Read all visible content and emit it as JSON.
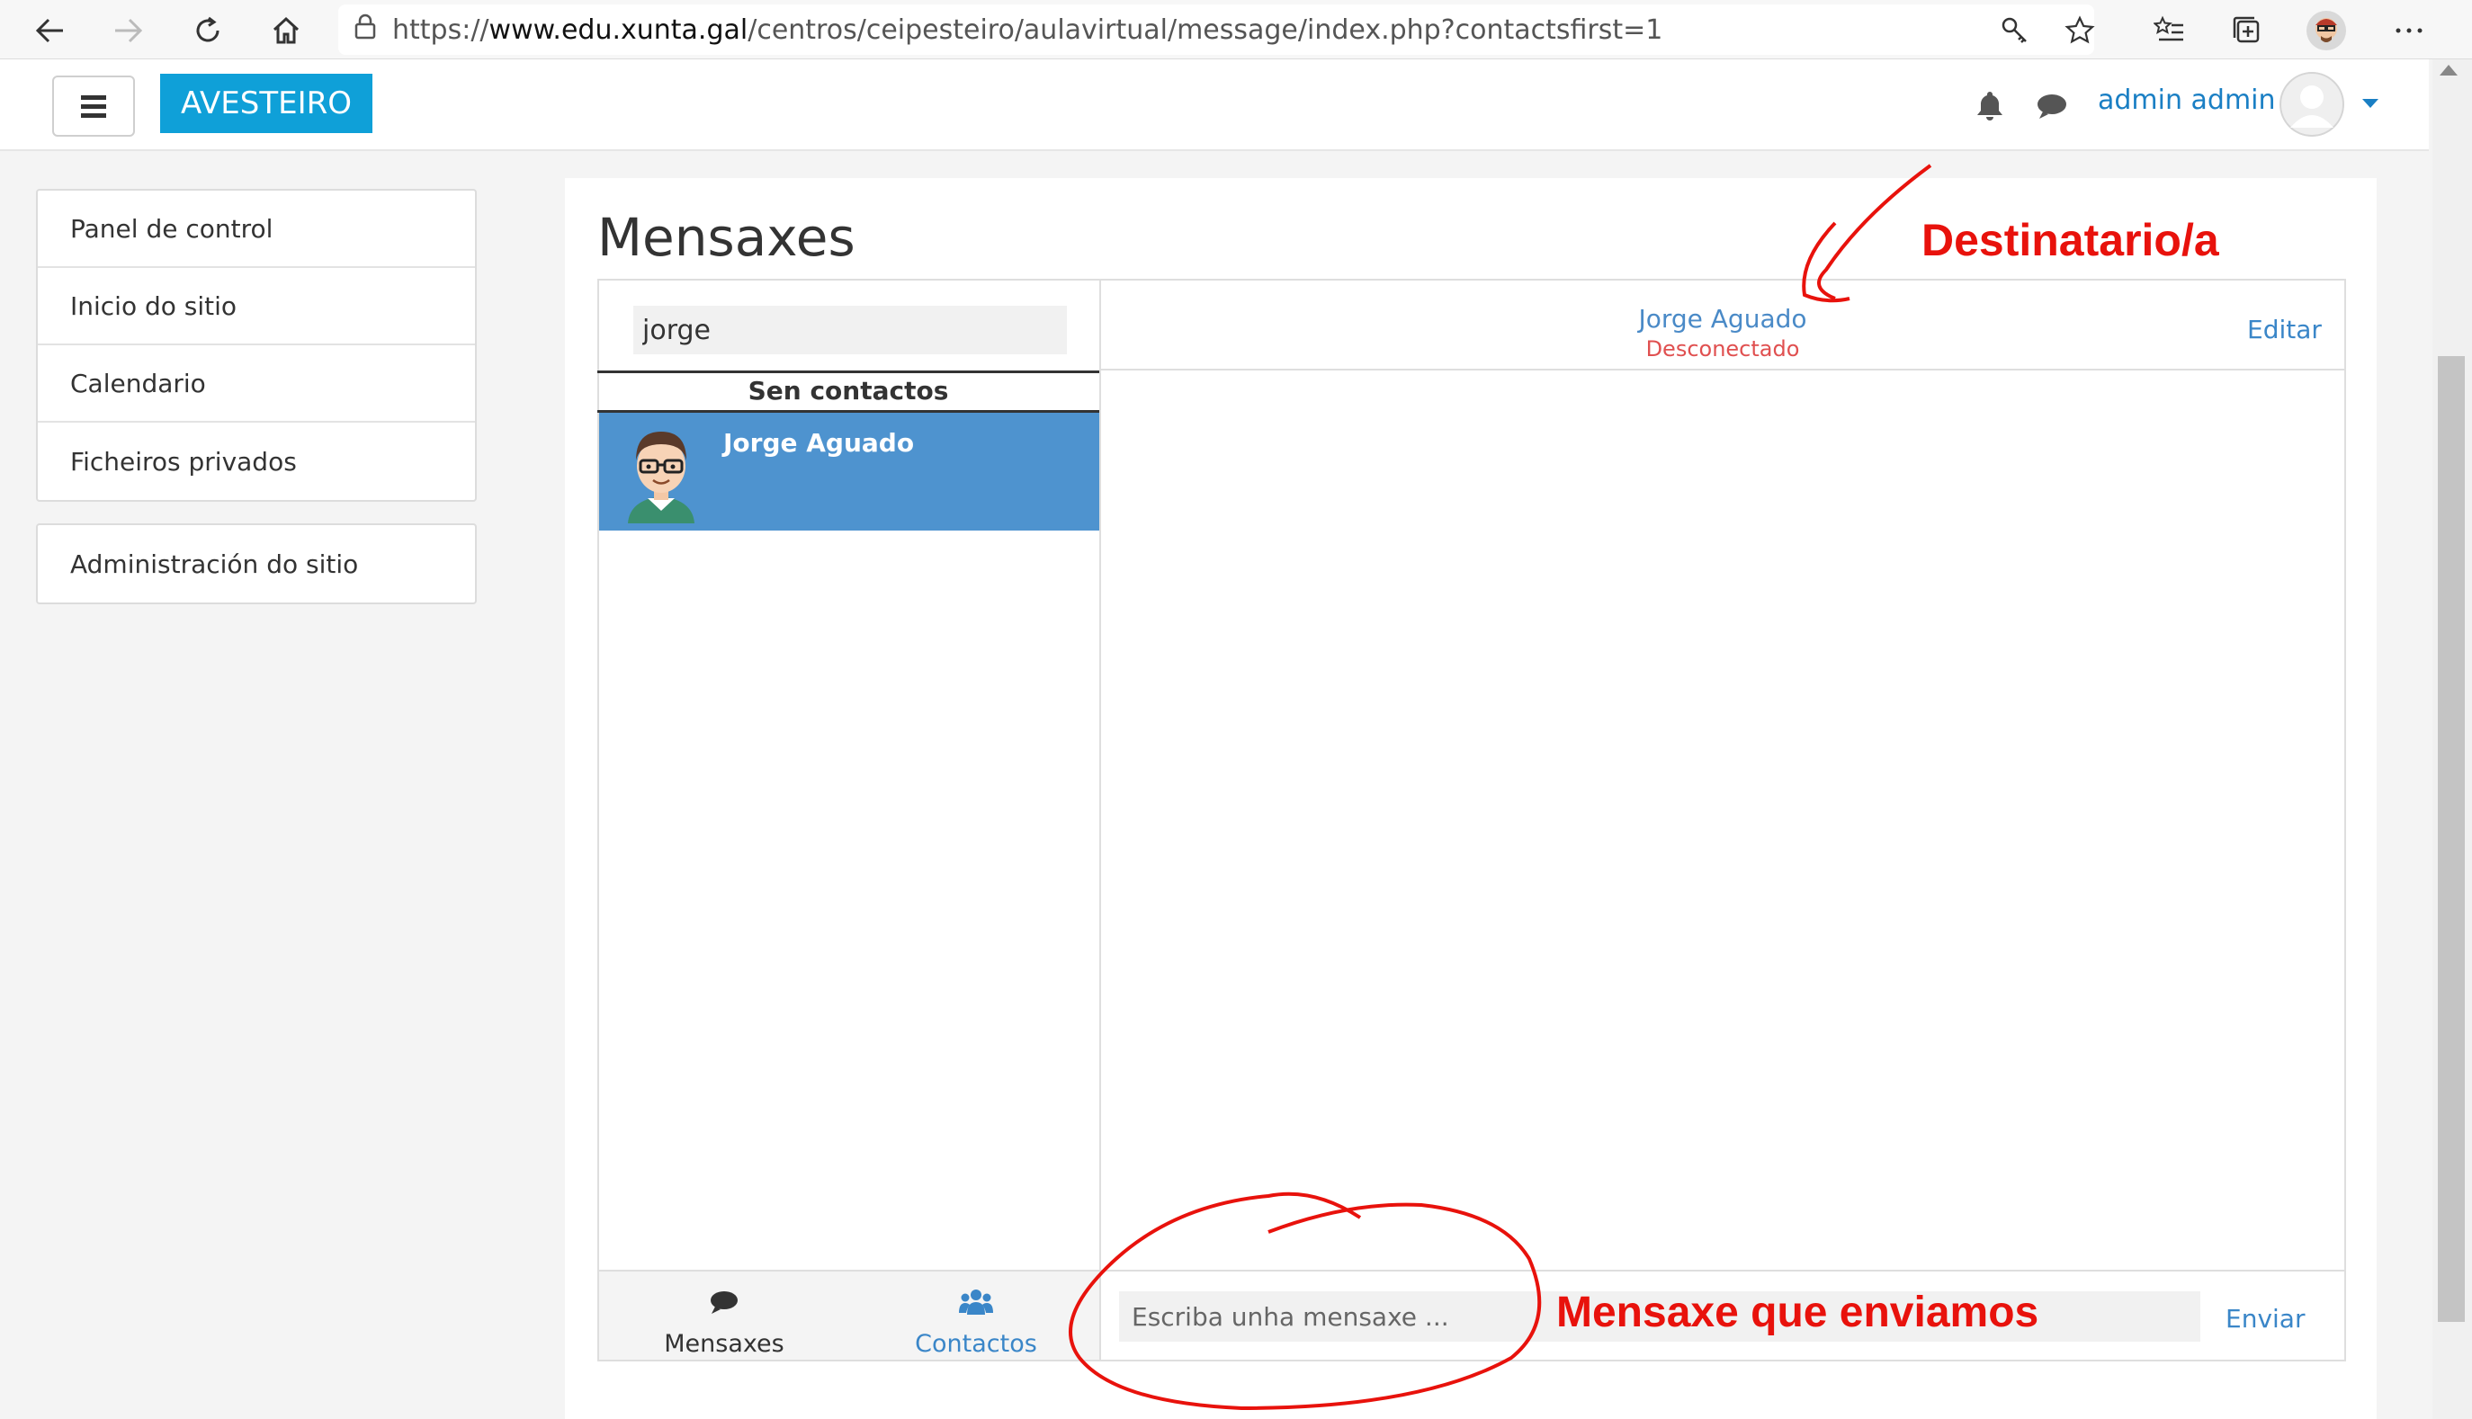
{
  "browser": {
    "url_prefix": "https://",
    "url_domain": "www.edu.xunta.gal",
    "url_path": "/centros/ceipesteiro/aulavirtual/message/index.php?contactsfirst=1"
  },
  "navbar": {
    "brand": "AVESTEIRO",
    "user_name": "admin admin"
  },
  "sidebar": {
    "items": [
      "Panel de control",
      "Inicio do sitio",
      "Calendario",
      "Ficheiros privados"
    ],
    "admin_item": "Administración do sitio"
  },
  "messages": {
    "page_title": "Mensaxes",
    "search_value": "jorge",
    "section_heading": "Sen contactos",
    "contact_name": "Jorge Aguado",
    "recipient_name": "Jorge Aguado",
    "recipient_status": "Desconectado",
    "edit_label": "Editar",
    "message_placeholder": "Escriba unha mensaxe ...",
    "send_label": "Enviar",
    "tabs": [
      "Mensaxes",
      "Contactos"
    ]
  },
  "annotations": {
    "recipient": "Destinatario/a",
    "message": "Mensaxe que enviamos",
    "color": "#e8120c"
  },
  "colors": {
    "brand": "#0fa0d8",
    "link": "#3a86c8",
    "selected_row": "#4e93cf",
    "offline": "#e05050"
  }
}
